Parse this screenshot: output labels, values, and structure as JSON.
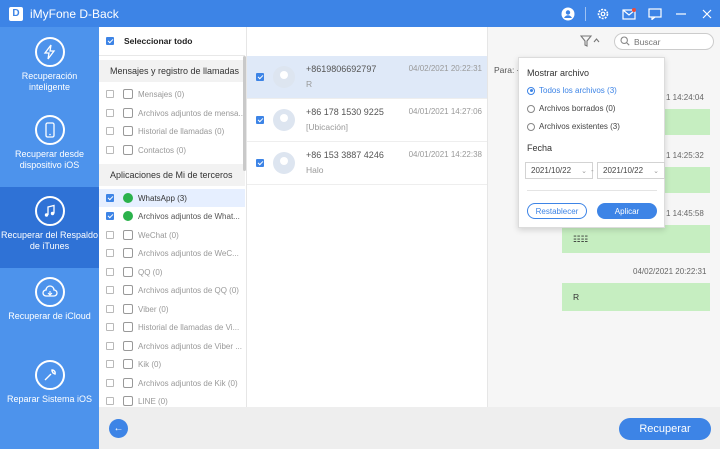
{
  "app": {
    "title": "iMyFone D-Back",
    "logo_letter": "D"
  },
  "titlebar_icons": [
    "user-icon",
    "gear-icon",
    "mail-icon",
    "chat-icon",
    "minimize-icon",
    "close-icon"
  ],
  "sidebar": {
    "items": [
      {
        "label": "Recuperación inteligente",
        "icon": "lightning-icon",
        "active": false
      },
      {
        "label": "Recuperar desde dispositivo iOS",
        "icon": "phone-icon",
        "active": false
      },
      {
        "label": "Recuperar del Respaldo de iTunes",
        "icon": "music-icon",
        "active": true
      },
      {
        "label": "Recuperar de iCloud",
        "icon": "cloud-icon",
        "active": false
      },
      {
        "label": "Reparar Sistema iOS",
        "icon": "wrench-icon",
        "active": false
      }
    ]
  },
  "categories": {
    "select_all": "Seleccionar todo",
    "group1": "Mensajes y registro de llamadas",
    "group1_items": [
      "Mensajes (0)",
      "Archivos adjuntos de mensa...",
      "Historial de llamadas (0)",
      "Contactos (0)"
    ],
    "group2": "Aplicaciones de Mi de terceros",
    "group2_items": [
      "WhatsApp (3)",
      "Archivos adjuntos de What...",
      "WeChat (0)",
      "Archivos adjuntos de WeC...",
      "QQ (0)",
      "Archivos adjuntos de QQ (0)",
      "Viber (0)",
      "Historial de llamadas de Vi...",
      "Archivos adjuntos de Viber ...",
      "Kik (0)",
      "Archivos adjuntos de Kik (0)",
      "LINE (0)"
    ]
  },
  "contacts": [
    {
      "number": "+8619806692797",
      "preview": "R",
      "date": "04/02/2021 20:22:31"
    },
    {
      "number": "+86 178 1530 9225",
      "preview": "[Ubicación]",
      "date": "04/01/2021 14:27:06"
    },
    {
      "number": "+86 153 3887 4246",
      "preview": "Halo",
      "date": "04/01/2021 14:22:38"
    }
  ],
  "chat": {
    "para_label": "Para: +",
    "messages": [
      {
        "time": "1 14:24:04",
        "text": ""
      },
      {
        "time": "1 14:25:32",
        "text": ""
      },
      {
        "time": "1 14:45:58",
        "text": "☷☷"
      },
      {
        "time": "04/02/2021 20:22:31",
        "text": "R"
      }
    ]
  },
  "search": {
    "placeholder": "Buscar"
  },
  "filter_popup": {
    "title": "Mostrar archivo",
    "options": [
      "Todos los archivos (3)",
      "Archivos borrados (0)",
      "Archivos existentes (3)"
    ],
    "selected": 0,
    "date_label": "Fecha",
    "date_from": "2021/10/22",
    "date_to": "2021/10/22",
    "dash": "-",
    "reset": "Restablecer",
    "apply": "Aplicar"
  },
  "bottom": {
    "recover": "Recuperar",
    "back": "←"
  },
  "colors": {
    "accent": "#3d84e6",
    "sidebar": "#4d93ec",
    "sidebar_active": "#2f72d6",
    "bubble": "#c6eec1"
  }
}
